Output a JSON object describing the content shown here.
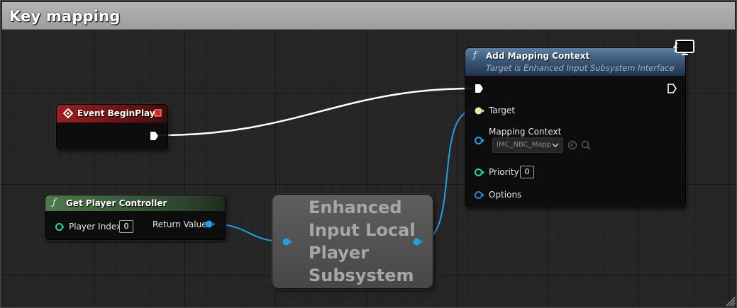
{
  "comment": {
    "title": "Key mapping"
  },
  "nodes": {
    "event_begin_play": {
      "title": "Event BeginPlay",
      "header_color": "#8f1d1d"
    },
    "get_player_controller": {
      "title": "Get Player Controller",
      "header_color": "#3b5d3a",
      "pins": {
        "player_index_label": "Player Index",
        "player_index_value": "0",
        "return_value_label": "Return Value"
      }
    },
    "enhanced_input_subsystem": {
      "title": "Enhanced\nInput Local\nPlayer\nSubsystem"
    },
    "add_mapping_context": {
      "title": "Add Mapping Context",
      "subtitle": "Target is Enhanced Input Subsystem Interface",
      "header_color": "#3d5a78",
      "pins": {
        "target_label": "Target",
        "mapping_context_label": "Mapping Context",
        "mapping_context_value": "IMC_NBC_Mapp",
        "priority_label": "Priority",
        "priority_value": "0",
        "options_label": "Options"
      }
    }
  },
  "colors": {
    "exec_wire": "#ffffff",
    "object_wire": "#1ea0e6",
    "struct_pin": "#2a7fd6",
    "int_pin": "#1fd8a8",
    "self_pin": "#e8f0a0"
  },
  "icons": {
    "fn_glyph": "ƒ",
    "event_icon": "event-diamond-icon",
    "target_type": "monitor-icon"
  }
}
